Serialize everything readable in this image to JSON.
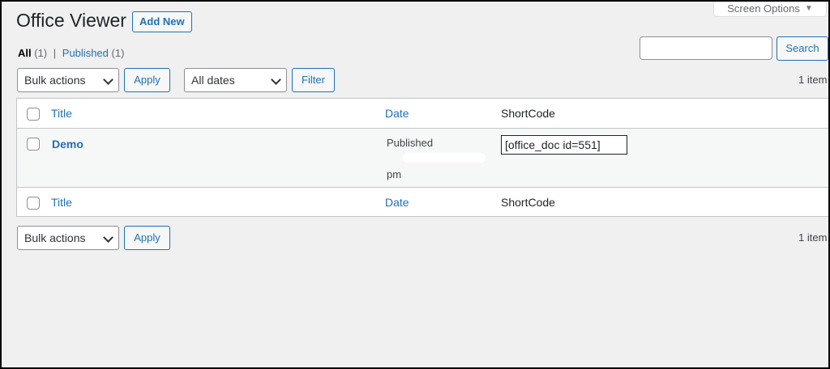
{
  "header": {
    "title": "Office Viewer",
    "add_new": "Add New",
    "screen_options": "Screen Options"
  },
  "filters": {
    "all_label": "All",
    "all_count": "(1)",
    "separator": "|",
    "published_label": "Published",
    "published_count": "(1)"
  },
  "search": {
    "value": "",
    "button": "Search"
  },
  "toolbar_top": {
    "bulk_actions": "Bulk actions",
    "apply": "Apply",
    "dates": "All dates",
    "filter": "Filter",
    "item_count": "1 item"
  },
  "table": {
    "columns": [
      "Title",
      "Date",
      "ShortCode"
    ],
    "rows": [
      {
        "title": "Demo",
        "status": "Published",
        "time": "pm",
        "shortcode": "[office_doc id=551]"
      }
    ]
  },
  "toolbar_bottom": {
    "bulk_actions": "Bulk actions",
    "apply": "Apply",
    "item_count": "1 item"
  },
  "colors": {
    "accent": "#2271b1",
    "background": "#f0f0f1"
  }
}
